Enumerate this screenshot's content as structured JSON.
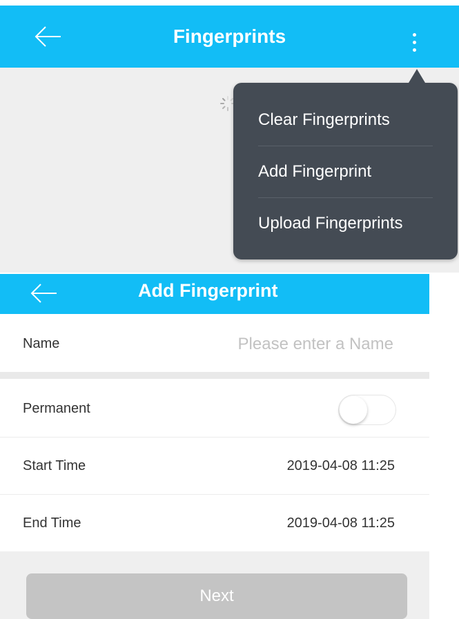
{
  "fingerprints_screen": {
    "title": "Fingerprints",
    "icons": {
      "back": "back-arrow-icon",
      "more": "more-vertical-icon",
      "loading": "loading-spinner-icon"
    },
    "menu": {
      "items": [
        {
          "label": "Clear Fingerprints"
        },
        {
          "label": "Add Fingerprint"
        },
        {
          "label": "Upload Fingerprints"
        }
      ]
    }
  },
  "add_fingerprint_screen": {
    "title": "Add Fingerprint",
    "name": {
      "label": "Name",
      "placeholder": "Please enter a Name",
      "value": ""
    },
    "permanent": {
      "label": "Permanent",
      "enabled": false
    },
    "start_time": {
      "label": "Start Time",
      "value": "2019-04-08 11:25"
    },
    "end_time": {
      "label": "End Time",
      "value": "2019-04-08 11:25"
    },
    "next_button": {
      "label": "Next",
      "enabled": false
    }
  },
  "colors": {
    "header": "#12bdf6",
    "menu_background": "#444b54",
    "background": "#efefef",
    "disabled_button": "#c4c4c4"
  }
}
